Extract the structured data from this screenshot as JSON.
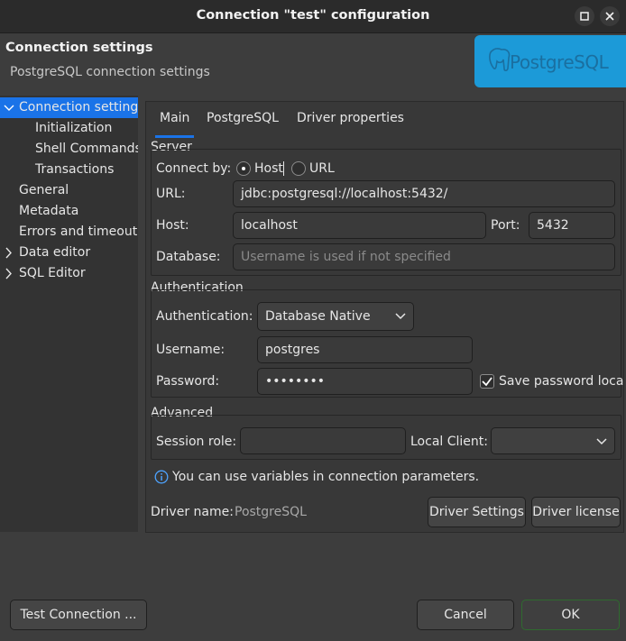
{
  "window": {
    "title": "Connection \"test\" configuration"
  },
  "header": {
    "title": "Connection settings",
    "subtitle": "PostgreSQL connection settings",
    "logo_text": "PostgreSQL"
  },
  "nav": {
    "items": [
      {
        "label": "Connection settings",
        "expanded": true,
        "selected": true
      },
      {
        "label": "Initialization"
      },
      {
        "label": "Shell Commands"
      },
      {
        "label": "Transactions"
      },
      {
        "label": "General"
      },
      {
        "label": "Metadata"
      },
      {
        "label": "Errors and timeouts"
      },
      {
        "label": "Data editor",
        "expandable": true
      },
      {
        "label": "SQL Editor",
        "expandable": true
      }
    ]
  },
  "tabs": [
    {
      "label": "Main",
      "active": true
    },
    {
      "label": "PostgreSQL"
    },
    {
      "label": "Driver properties"
    }
  ],
  "server": {
    "group_label": "Server",
    "connect_by_label": "Connect by:",
    "host_option": "Host",
    "url_option": "URL",
    "selected_option": "Host",
    "url_label": "URL:",
    "url_value": "jdbc:postgresql://localhost:5432/",
    "host_label": "Host:",
    "host_value": "localhost",
    "port_label": "Port:",
    "port_value": "5432",
    "database_label": "Database:",
    "database_placeholder": "Username is used if not specified"
  },
  "auth": {
    "group_label": "Authentication",
    "auth_label": "Authentication:",
    "auth_value": "Database Native",
    "username_label": "Username:",
    "username_value": "postgres",
    "password_label": "Password:",
    "password_value": "••••••••",
    "save_password_label": "Save password loca",
    "save_password_checked": true
  },
  "advanced": {
    "group_label": "Advanced",
    "session_role_label": "Session role:",
    "session_role_value": "",
    "local_client_label": "Local Client:",
    "local_client_value": ""
  },
  "info_text": "You can use variables in connection parameters.",
  "driver": {
    "name_label": "Driver name:",
    "name_value": "PostgreSQL",
    "settings_button": "Driver Settings",
    "license_button": "Driver license"
  },
  "footer": {
    "test_button": "Test Connection ...",
    "cancel_button": "Cancel",
    "ok_button": "OK"
  },
  "colors": {
    "accent": "#1a73e8",
    "logo_bg": "#1c9ad8",
    "ok_border": "#2f6b2f"
  }
}
